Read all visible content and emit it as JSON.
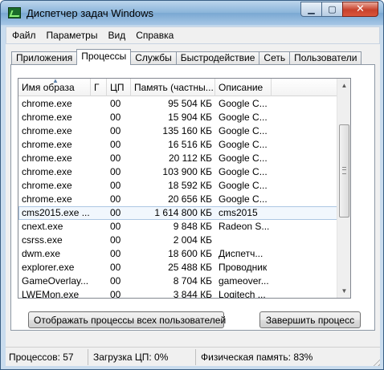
{
  "window": {
    "title": "Диспетчер задач Windows",
    "controls": {
      "minimize": "▁",
      "maximize": "▢",
      "close": "✕"
    }
  },
  "menu": [
    "Файл",
    "Параметры",
    "Вид",
    "Справка"
  ],
  "tabs": [
    {
      "label": "Приложения",
      "active": false
    },
    {
      "label": "Процессы",
      "active": true
    },
    {
      "label": "Службы",
      "active": false
    },
    {
      "label": "Быстродействие",
      "active": false
    },
    {
      "label": "Сеть",
      "active": false
    },
    {
      "label": "Пользователи",
      "active": false
    }
  ],
  "table": {
    "columns": [
      "Имя образа",
      "Г",
      "ЦП",
      "Память (частны...",
      "Описание"
    ],
    "rows": [
      {
        "name": "chrome.exe",
        "cpu": "00",
        "mem": "95 504 КБ",
        "desc": "Google C..."
      },
      {
        "name": "chrome.exe",
        "cpu": "00",
        "mem": "15 904 КБ",
        "desc": "Google C..."
      },
      {
        "name": "chrome.exe",
        "cpu": "00",
        "mem": "135 160 КБ",
        "desc": "Google C..."
      },
      {
        "name": "chrome.exe",
        "cpu": "00",
        "mem": "16 516 КБ",
        "desc": "Google C..."
      },
      {
        "name": "chrome.exe",
        "cpu": "00",
        "mem": "20 112 КБ",
        "desc": "Google C..."
      },
      {
        "name": "chrome.exe",
        "cpu": "00",
        "mem": "103 900 КБ",
        "desc": "Google C..."
      },
      {
        "name": "chrome.exe",
        "cpu": "00",
        "mem": "18 592 КБ",
        "desc": "Google C..."
      },
      {
        "name": "chrome.exe",
        "cpu": "00",
        "mem": "20 656 КБ",
        "desc": "Google C..."
      },
      {
        "name": "cms2015.exe ...",
        "cpu": "00",
        "mem": "1 614 800 КБ",
        "desc": "cms2015",
        "selected": true
      },
      {
        "name": "cnext.exe",
        "cpu": "00",
        "mem": "9 848 КБ",
        "desc": "Radeon S..."
      },
      {
        "name": "csrss.exe",
        "cpu": "00",
        "mem": "2 004 КБ",
        "desc": ""
      },
      {
        "name": "dwm.exe",
        "cpu": "00",
        "mem": "18 600 КБ",
        "desc": "Диспетч..."
      },
      {
        "name": "explorer.exe",
        "cpu": "00",
        "mem": "25 488 КБ",
        "desc": "Проводник"
      },
      {
        "name": "GameOverlay...",
        "cpu": "00",
        "mem": "8 704 КБ",
        "desc": "gameover..."
      },
      {
        "name": "LWEMon.exe",
        "cpu": "00",
        "mem": "3 844 КБ",
        "desc": "Logitech ..."
      }
    ]
  },
  "buttons": {
    "show_all": "Отображать процессы всех пользователей",
    "end_process": "Завершить процесс"
  },
  "status": {
    "processes": "Процессов: 57",
    "cpu": "Загрузка ЦП: 0%",
    "memory": "Физическая память: 83%"
  }
}
